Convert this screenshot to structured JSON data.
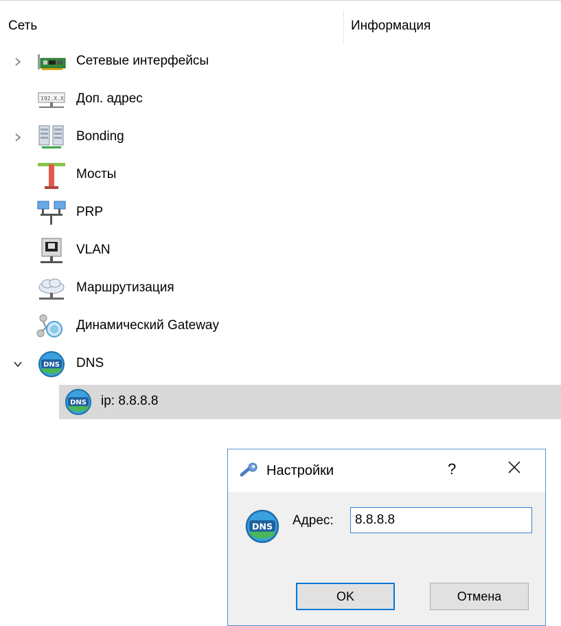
{
  "header": {
    "col_network": "Сеть",
    "col_info": "Информация"
  },
  "tree": {
    "items": [
      {
        "label": "Сетевые интерфейсы",
        "icon": "network-card-icon",
        "expander": "collapsed"
      },
      {
        "label": "Доп. адрес",
        "icon": "ip-address-icon",
        "expander": "none"
      },
      {
        "label": "Bonding",
        "icon": "bonding-servers-icon",
        "expander": "collapsed"
      },
      {
        "label": "Мосты",
        "icon": "bridge-icon",
        "expander": "none"
      },
      {
        "label": "PRP",
        "icon": "prp-network-icon",
        "expander": "none"
      },
      {
        "label": "VLAN",
        "icon": "vlan-icon",
        "expander": "none"
      },
      {
        "label": "Маршрутизация",
        "icon": "routing-cloud-icon",
        "expander": "none"
      },
      {
        "label": "Динамический Gateway",
        "icon": "dynamic-gateway-icon",
        "expander": "none"
      },
      {
        "label": "DNS",
        "icon": "dns-globe-icon",
        "expander": "expanded"
      },
      {
        "label": "ip: 8.8.8.8",
        "icon": "dns-globe-icon",
        "expander": "child",
        "selected": true
      }
    ]
  },
  "dialog": {
    "title": "Настройки",
    "help": "?",
    "field_label": "Адрес:",
    "field_value": "8.8.8.8",
    "ok_label": "OK",
    "cancel_label": "Отмена",
    "dns_badge": "DNS"
  },
  "colors": {
    "selected_row": "#d9d9d9",
    "dialog_border": "#5b8fd6",
    "accent": "#0078d7"
  }
}
